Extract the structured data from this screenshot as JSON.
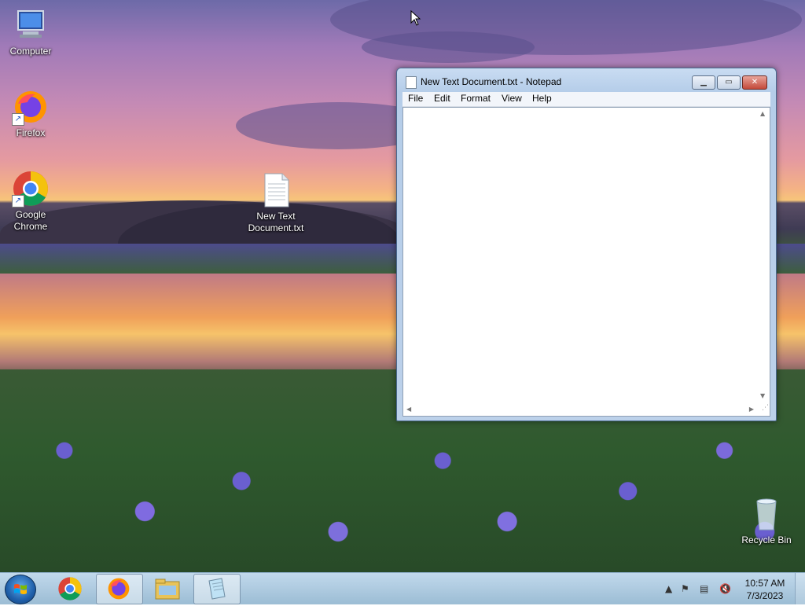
{
  "desktop": {
    "icons": [
      {
        "label": "Computer"
      },
      {
        "label": "Firefox"
      },
      {
        "label": "Google Chrome"
      },
      {
        "label": "New Text Document.txt"
      },
      {
        "label": "Recycle Bin"
      }
    ]
  },
  "notepad": {
    "title": "New Text Document.txt - Notepad",
    "menu": [
      "File",
      "Edit",
      "Format",
      "View",
      "Help"
    ],
    "content": ""
  },
  "taskbar": {
    "pinned": [
      "start-icon",
      "chrome-icon",
      "firefox-icon",
      "file-explorer-icon",
      "notepad-icon"
    ],
    "tray": [
      "show-hidden-icons-icon",
      "action-center-icon",
      "network-icon",
      "volume-muted-icon"
    ],
    "time": "10:57 AM",
    "date": "7/3/2023"
  },
  "colors": {
    "taskbar": "#a7c4dc",
    "window_frame": "#bcd1ea",
    "close_button": "#c4493a"
  }
}
